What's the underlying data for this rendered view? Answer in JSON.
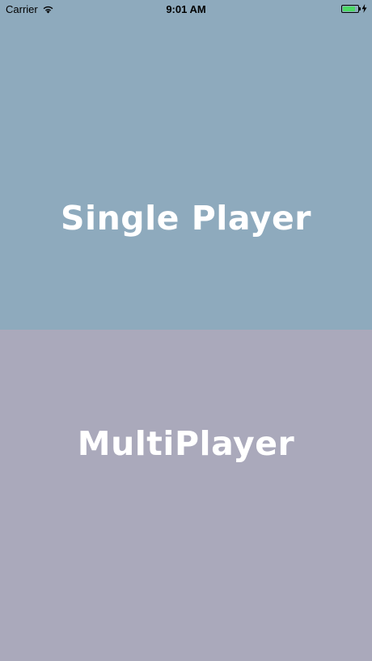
{
  "status_bar": {
    "carrier": "Carrier",
    "time": "9:01 AM",
    "battery_level": 0.85,
    "battery_color": "#4cd964",
    "icons": [
      "wifi-icon",
      "battery-icon",
      "charging-bolt-icon"
    ]
  },
  "menu": {
    "single_player_label": "Single Player",
    "single_player_color": "#8eaabd",
    "multiplayer_label": "MultiPlayer",
    "multiplayer_color": "#aaa9bb"
  }
}
